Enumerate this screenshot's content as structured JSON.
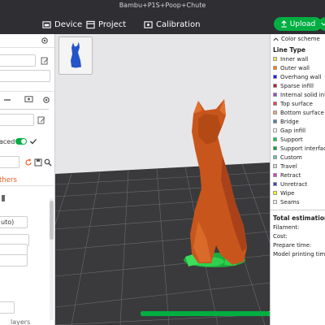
{
  "window": {
    "title": "Bambu+P1S+Poop+Chute"
  },
  "nav": {
    "tabs": [
      {
        "label": "Device"
      },
      {
        "label": "Project"
      },
      {
        "label": "Calibration"
      }
    ],
    "upload_label": "Upload"
  },
  "left_panel": {
    "toggle_label": "aced",
    "others_label": "thers",
    "auto_label": "uto)",
    "layers_label": "layers"
  },
  "progress": {
    "fraction": 0.97
  },
  "right_panel": {
    "color_scheme_label": "Color scheme",
    "line_type_label": "Line Type",
    "legend": [
      {
        "label": "Inner wall",
        "color": "#ffe44c"
      },
      {
        "label": "Outer wall",
        "color": "#ff7f00"
      },
      {
        "label": "Overhang wall",
        "color": "#1a1aff"
      },
      {
        "label": "Sparse infill",
        "color": "#b11e1e"
      },
      {
        "label": "Internal solid infill",
        "color": "#9a46c7"
      },
      {
        "label": "Top surface",
        "color": "#f04040"
      },
      {
        "label": "Bottom surface",
        "color": "#ff9e7a"
      },
      {
        "label": "Bridge",
        "color": "#4d80ba"
      },
      {
        "label": "Gap infill",
        "color": "#ffffff"
      },
      {
        "label": "Support",
        "color": "#00d040"
      },
      {
        "label": "Support interface",
        "color": "#00a030"
      },
      {
        "label": "Custom",
        "color": "#5ecc9e"
      },
      {
        "label": "Travel",
        "color": "#d8d8d8"
      },
      {
        "label": "Retract",
        "color": "#d43fd1"
      },
      {
        "label": "Unretract",
        "color": "#3f3fd4"
      },
      {
        "label": "Wipe",
        "color": "#ffff00"
      },
      {
        "label": "Seams",
        "color": "#eeeeee"
      }
    ],
    "estimation": {
      "title": "Total estimation",
      "filament": "Filament:",
      "cost": "Cost:",
      "prepare": "Prepare time:",
      "model": "Model printing time:"
    }
  }
}
